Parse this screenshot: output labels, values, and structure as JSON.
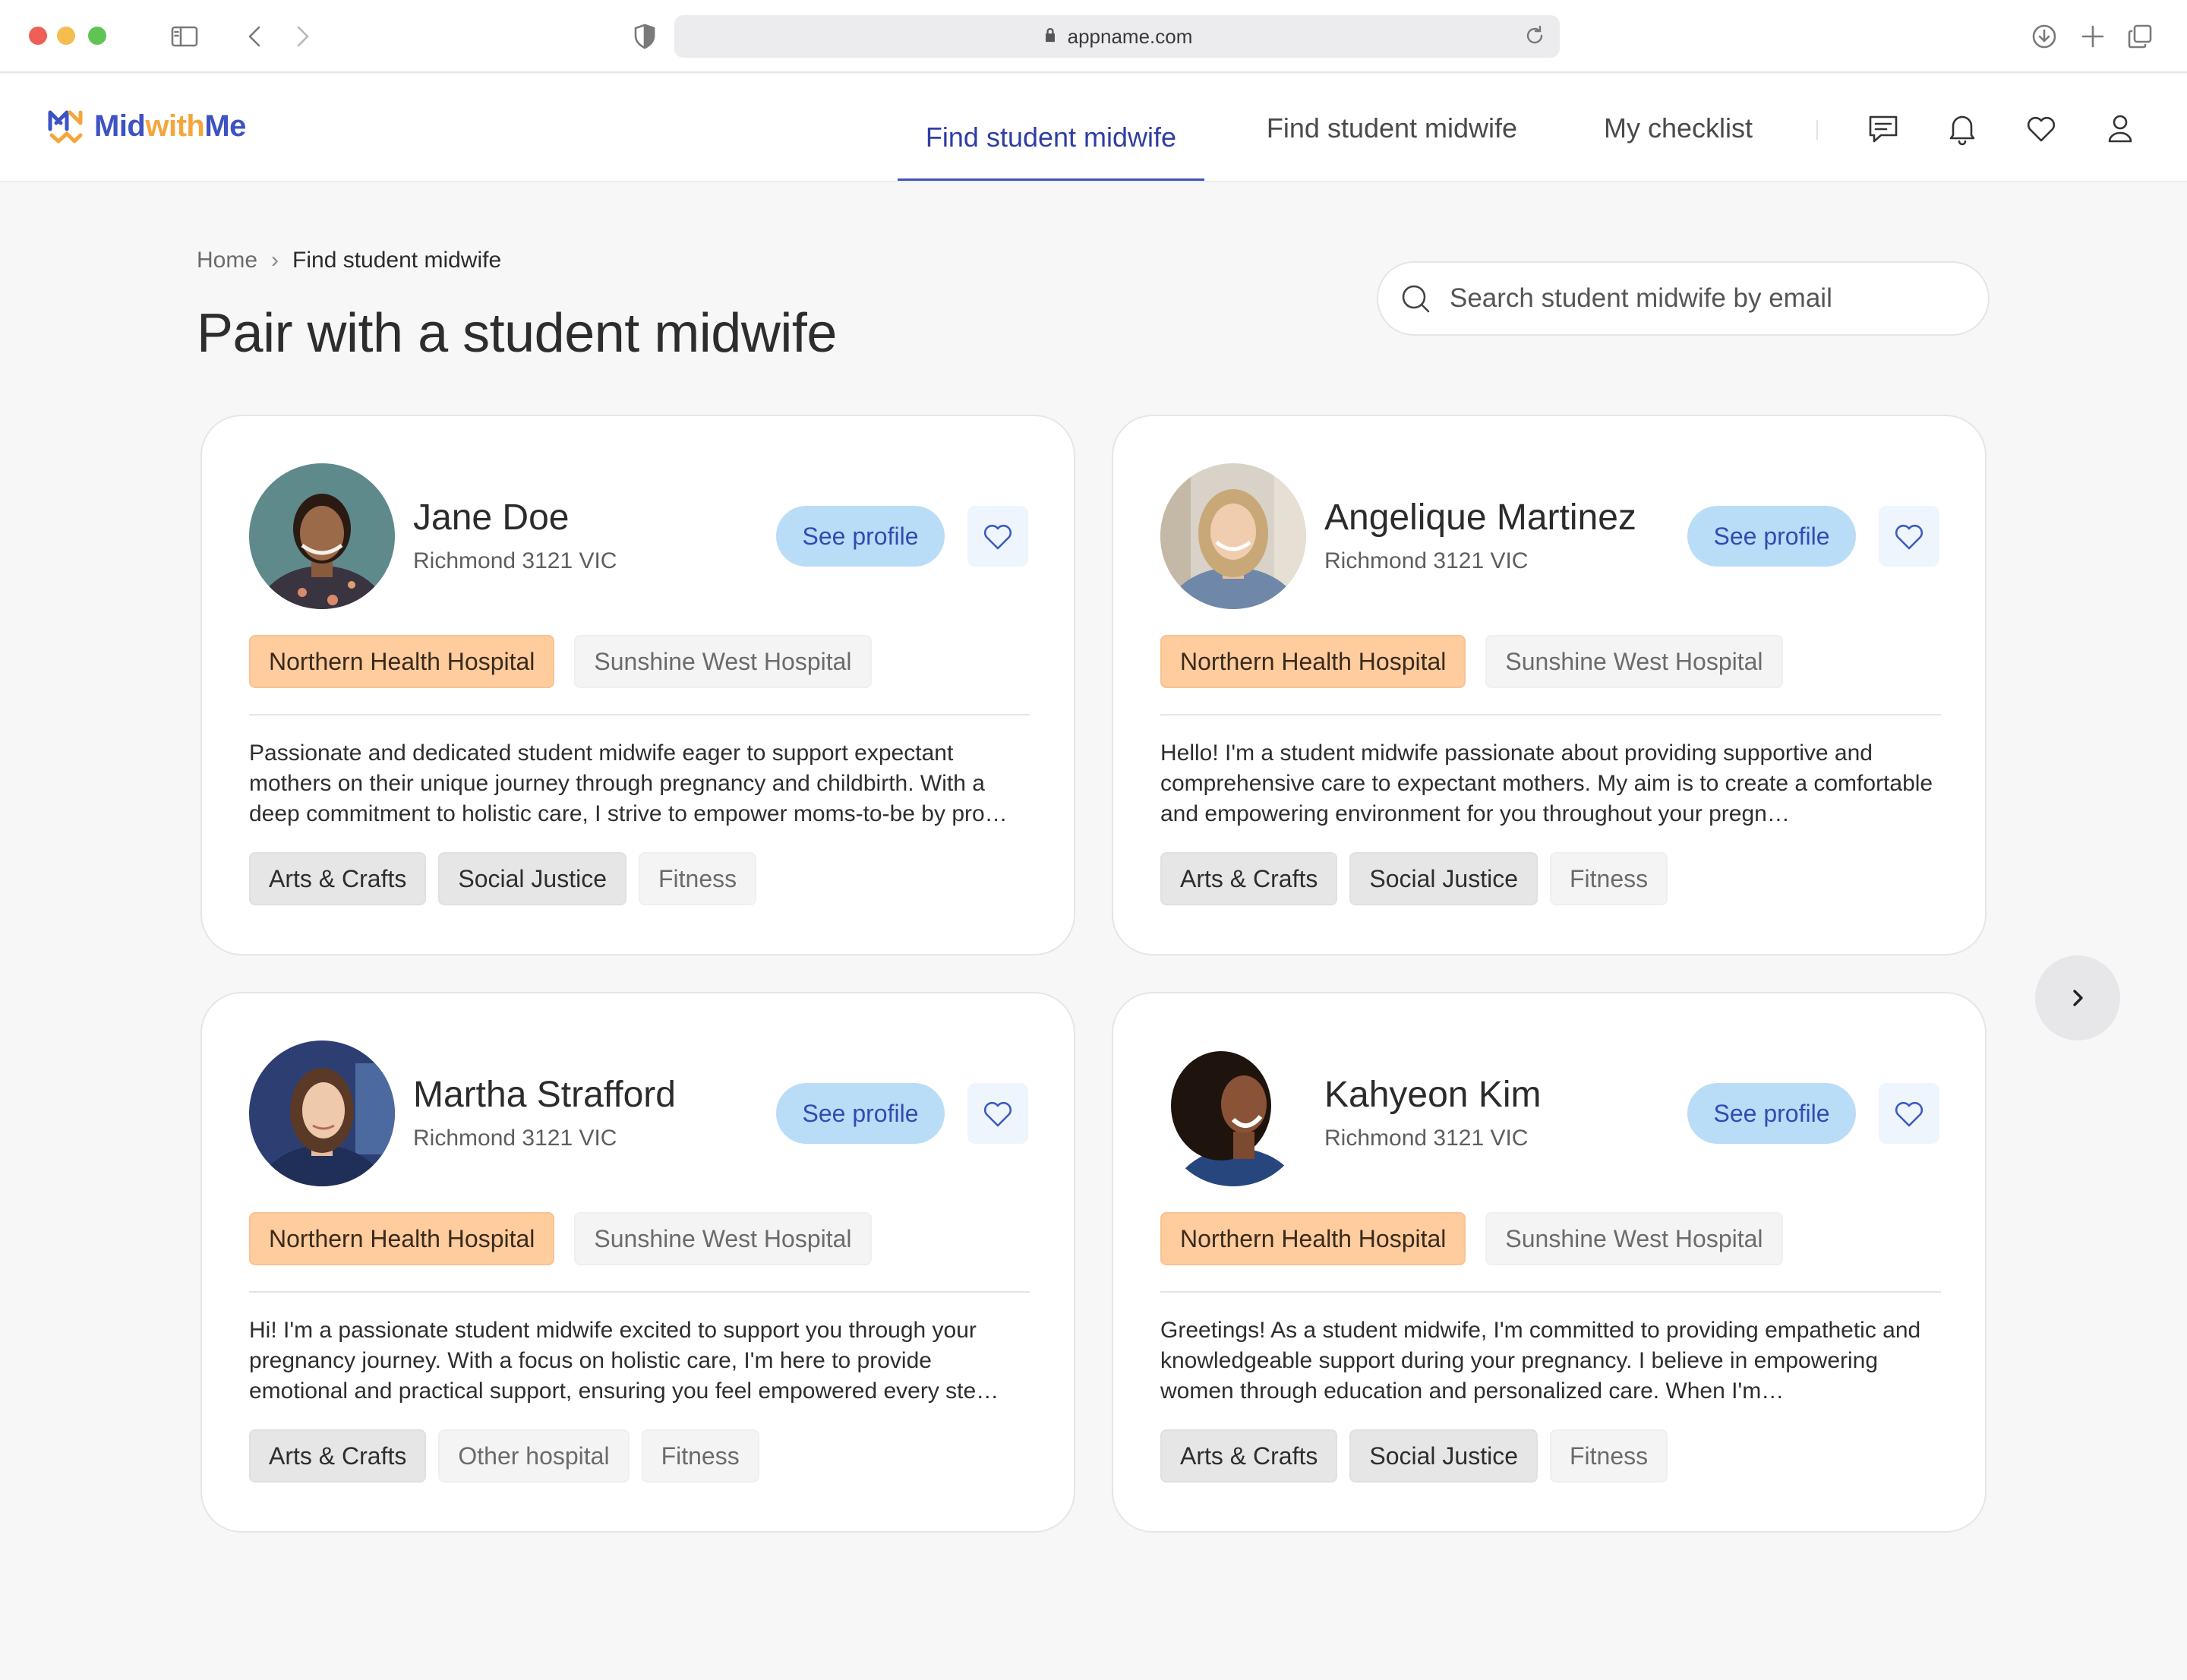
{
  "browser": {
    "url": "appname.com"
  },
  "app": {
    "logo": {
      "part1": "Mid",
      "part2": "with",
      "part3": "Me"
    },
    "nav": [
      {
        "label": "Find student midwife",
        "active": true
      },
      {
        "label": "Find student midwife",
        "active": false
      },
      {
        "label": "My checklist",
        "active": false
      }
    ],
    "icons": [
      "message-icon",
      "bell-icon",
      "heart-icon",
      "user-icon"
    ]
  },
  "page": {
    "breadcrumb": {
      "home": "Home",
      "separator": "›",
      "current": "Find student midwife"
    },
    "title": "Pair with a student midwife",
    "search": {
      "placeholder": "Search student midwife by email",
      "value": ""
    }
  },
  "cards": [
    {
      "name": "Jane Doe",
      "location": "Richmond 3121 VIC",
      "see_profile": "See profile",
      "hospitals": [
        "Northern Health Hospital",
        "Sunshine West Hospital"
      ],
      "bio": "Passionate and dedicated student midwife eager to support expectant mothers on their unique journey through pregnancy and childbirth. With a deep commitment to holistic care, I strive to empower moms-to-be by pro…",
      "tags": [
        "Arts & Crafts",
        "Social Justice",
        "Fitness"
      ]
    },
    {
      "name": "Angelique Martinez",
      "location": "Richmond 3121 VIC",
      "see_profile": "See profile",
      "hospitals": [
        "Northern Health Hospital",
        "Sunshine West Hospital"
      ],
      "bio": "Hello! I'm a student midwife passionate about providing supportive and comprehensive care to expectant mothers. My aim is to create a comfortable and empowering environment for you throughout your pregn…",
      "tags": [
        "Arts & Crafts",
        "Social Justice",
        "Fitness"
      ]
    },
    {
      "name": "Martha Strafford",
      "location": "Richmond 3121 VIC",
      "see_profile": "See profile",
      "hospitals": [
        "Northern Health Hospital",
        "Sunshine West Hospital"
      ],
      "bio": "Hi! I'm a passionate student midwife excited to support you through your pregnancy journey. With a focus on holistic care, I'm here to provide emotional and practical support, ensuring you feel empowered every ste…",
      "tags": [
        "Arts & Crafts",
        "Other hospital",
        "Fitness"
      ]
    },
    {
      "name": "Kahyeon Kim",
      "location": "Richmond 3121 VIC",
      "see_profile": "See profile",
      "hospitals": [
        "Northern Health Hospital",
        "Sunshine West Hospital"
      ],
      "bio": "Greetings! As a student midwife, I'm committed to providing empathetic and knowledgeable support during your pregnancy. I believe in empowering women through education and personalized care. When I'm…",
      "tags": [
        "Arts & Crafts",
        "Social Justice",
        "Fitness"
      ]
    }
  ],
  "colors": {
    "brand_blue": "#3d53c4",
    "brand_orange": "#f4a63b",
    "primary_chip": "#ffcc9e",
    "button_bg": "#b9dcf7"
  }
}
